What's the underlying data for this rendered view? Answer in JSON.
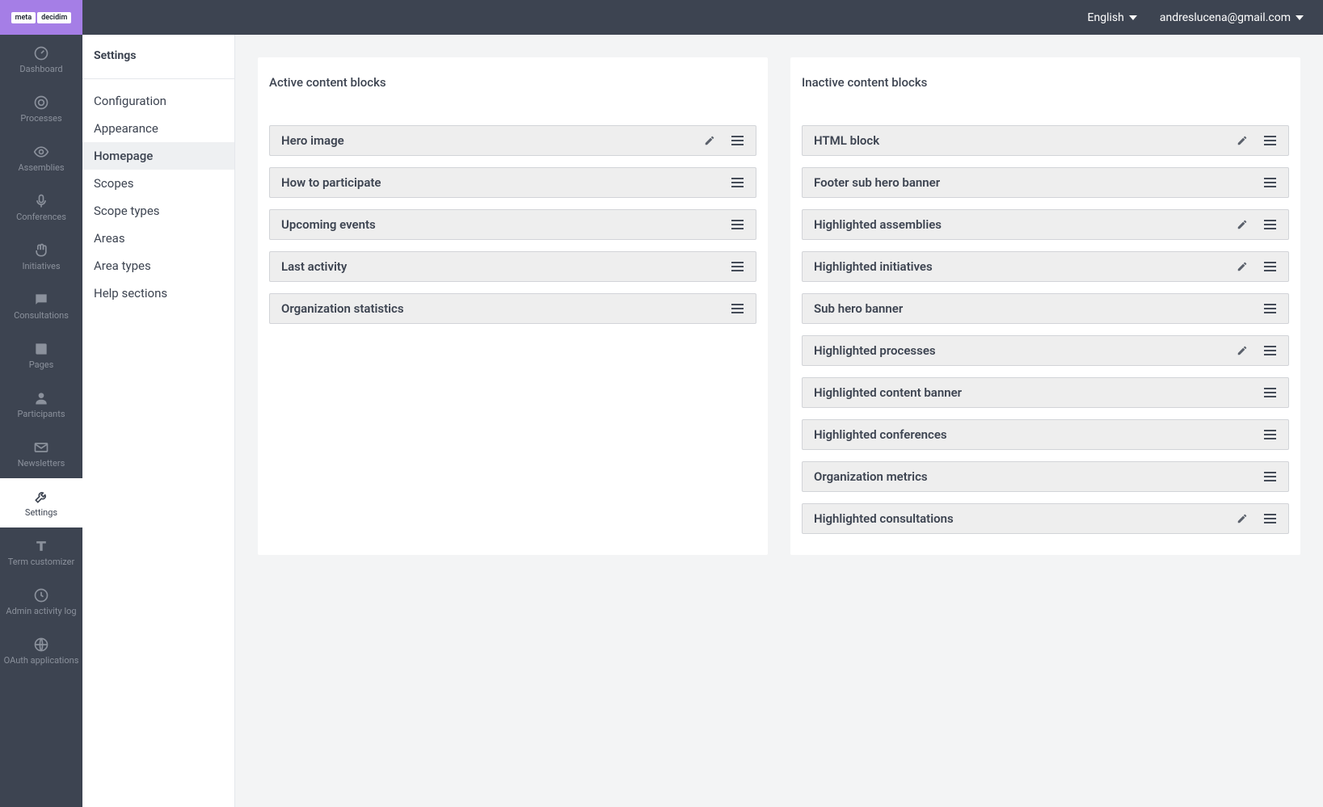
{
  "topbar": {
    "language": "English",
    "user_email": "andreslucena@gmail.com"
  },
  "logo": {
    "part1": "meta",
    "part2": "decidim"
  },
  "sidebar": [
    {
      "label": "Dashboard",
      "icon": "gauge"
    },
    {
      "label": "Processes",
      "icon": "target"
    },
    {
      "label": "Assemblies",
      "icon": "eye"
    },
    {
      "label": "Conferences",
      "icon": "mic"
    },
    {
      "label": "Initiatives",
      "icon": "hands"
    },
    {
      "label": "Consultations",
      "icon": "chat"
    },
    {
      "label": "Pages",
      "icon": "book"
    },
    {
      "label": "Participants",
      "icon": "person"
    },
    {
      "label": "Newsletters",
      "icon": "envelope"
    },
    {
      "label": "Settings",
      "icon": "wrench",
      "active": true
    },
    {
      "label": "Term customizer",
      "icon": "text"
    },
    {
      "label": "Admin activity log",
      "icon": "clock"
    },
    {
      "label": "OAuth applications",
      "icon": "globe"
    }
  ],
  "subsidebar": {
    "title": "Settings",
    "items": [
      {
        "label": "Configuration"
      },
      {
        "label": "Appearance"
      },
      {
        "label": "Homepage",
        "active": true
      },
      {
        "label": "Scopes"
      },
      {
        "label": "Scope types"
      },
      {
        "label": "Areas"
      },
      {
        "label": "Area types"
      },
      {
        "label": "Help sections"
      }
    ]
  },
  "panels": {
    "active": {
      "title": "Active content blocks",
      "blocks": [
        {
          "label": "Hero image",
          "editable": true
        },
        {
          "label": "How to participate",
          "editable": false
        },
        {
          "label": "Upcoming events",
          "editable": false
        },
        {
          "label": "Last activity",
          "editable": false
        },
        {
          "label": "Organization statistics",
          "editable": false
        }
      ]
    },
    "inactive": {
      "title": "Inactive content blocks",
      "blocks": [
        {
          "label": "HTML block",
          "editable": true
        },
        {
          "label": "Footer sub hero banner",
          "editable": false
        },
        {
          "label": "Highlighted assemblies",
          "editable": true
        },
        {
          "label": "Highlighted initiatives",
          "editable": true
        },
        {
          "label": "Sub hero banner",
          "editable": false
        },
        {
          "label": "Highlighted processes",
          "editable": true
        },
        {
          "label": "Highlighted content banner",
          "editable": false
        },
        {
          "label": "Highlighted conferences",
          "editable": false
        },
        {
          "label": "Organization metrics",
          "editable": false
        },
        {
          "label": "Highlighted consultations",
          "editable": true
        }
      ]
    }
  }
}
